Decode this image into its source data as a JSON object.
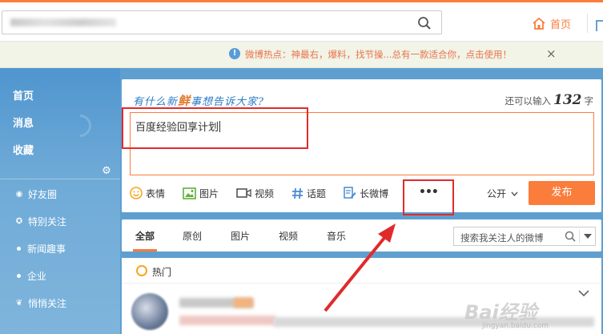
{
  "topbar": {
    "home_label": "首页"
  },
  "notice": {
    "text": "微博热点：神最右，爆料，找节操...总有一款适合你，点击使用！",
    "close": "×"
  },
  "nav": {
    "main": [
      "首页",
      "消息",
      "收藏"
    ],
    "sub": [
      {
        "label": "好友圈",
        "icon": "circle-dot-icon"
      },
      {
        "label": "特别关注",
        "icon": "star-circle-icon"
      },
      {
        "label": "新闻趣事",
        "icon": "dot"
      },
      {
        "label": "企业",
        "icon": "dot"
      },
      {
        "label": "悄悄关注",
        "icon": "leaf-icon"
      }
    ]
  },
  "compose": {
    "prompt_pre": "有什么新",
    "prompt_highlight": "鲜",
    "prompt_post": "事想告诉大家?",
    "limit_pre": "还可以输入",
    "limit_num": "132",
    "limit_post": "字",
    "input_text": "百度经验回享计划",
    "tools": [
      "表情",
      "图片",
      "视频",
      "话题",
      "长微博"
    ],
    "more": "•••",
    "privacy": "公开",
    "publish": "发布"
  },
  "filter": {
    "tabs": [
      "全部",
      "原创",
      "图片",
      "视频",
      "音乐"
    ],
    "search_placeholder": "搜索我关注人的微博"
  },
  "feed": {
    "hot_label": "热门"
  },
  "watermark": {
    "main": "Bai经验",
    "sub": "jingyan.baidu.com"
  },
  "colors": {
    "accent": "#fa7d3c",
    "annotation_red": "#e02b2b",
    "nav_blue": "#5f9fd0",
    "link_blue": "#2b7cc8"
  }
}
